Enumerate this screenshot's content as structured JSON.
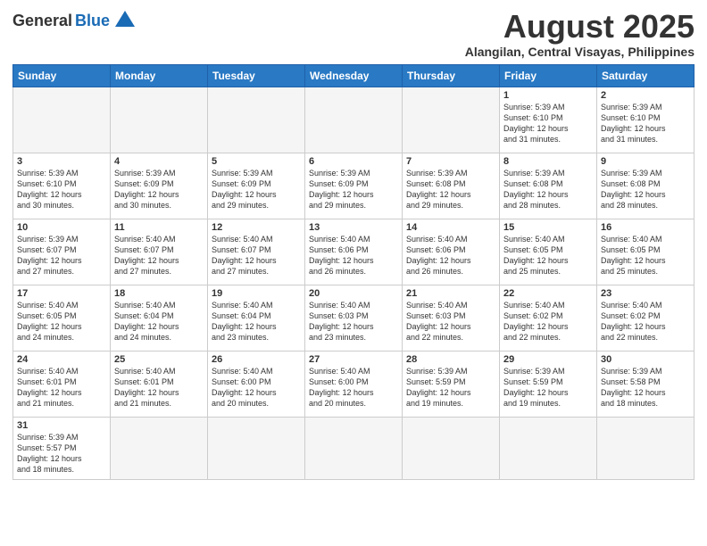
{
  "header": {
    "logo_general": "General",
    "logo_blue": "Blue",
    "month_title": "August 2025",
    "location": "Alangilan, Central Visayas, Philippines"
  },
  "weekdays": [
    "Sunday",
    "Monday",
    "Tuesday",
    "Wednesday",
    "Thursday",
    "Friday",
    "Saturday"
  ],
  "weeks": [
    [
      {
        "day": "",
        "info": ""
      },
      {
        "day": "",
        "info": ""
      },
      {
        "day": "",
        "info": ""
      },
      {
        "day": "",
        "info": ""
      },
      {
        "day": "",
        "info": ""
      },
      {
        "day": "1",
        "info": "Sunrise: 5:39 AM\nSunset: 6:10 PM\nDaylight: 12 hours\nand 31 minutes."
      },
      {
        "day": "2",
        "info": "Sunrise: 5:39 AM\nSunset: 6:10 PM\nDaylight: 12 hours\nand 31 minutes."
      }
    ],
    [
      {
        "day": "3",
        "info": "Sunrise: 5:39 AM\nSunset: 6:10 PM\nDaylight: 12 hours\nand 30 minutes."
      },
      {
        "day": "4",
        "info": "Sunrise: 5:39 AM\nSunset: 6:09 PM\nDaylight: 12 hours\nand 30 minutes."
      },
      {
        "day": "5",
        "info": "Sunrise: 5:39 AM\nSunset: 6:09 PM\nDaylight: 12 hours\nand 29 minutes."
      },
      {
        "day": "6",
        "info": "Sunrise: 5:39 AM\nSunset: 6:09 PM\nDaylight: 12 hours\nand 29 minutes."
      },
      {
        "day": "7",
        "info": "Sunrise: 5:39 AM\nSunset: 6:08 PM\nDaylight: 12 hours\nand 29 minutes."
      },
      {
        "day": "8",
        "info": "Sunrise: 5:39 AM\nSunset: 6:08 PM\nDaylight: 12 hours\nand 28 minutes."
      },
      {
        "day": "9",
        "info": "Sunrise: 5:39 AM\nSunset: 6:08 PM\nDaylight: 12 hours\nand 28 minutes."
      }
    ],
    [
      {
        "day": "10",
        "info": "Sunrise: 5:39 AM\nSunset: 6:07 PM\nDaylight: 12 hours\nand 27 minutes."
      },
      {
        "day": "11",
        "info": "Sunrise: 5:40 AM\nSunset: 6:07 PM\nDaylight: 12 hours\nand 27 minutes."
      },
      {
        "day": "12",
        "info": "Sunrise: 5:40 AM\nSunset: 6:07 PM\nDaylight: 12 hours\nand 27 minutes."
      },
      {
        "day": "13",
        "info": "Sunrise: 5:40 AM\nSunset: 6:06 PM\nDaylight: 12 hours\nand 26 minutes."
      },
      {
        "day": "14",
        "info": "Sunrise: 5:40 AM\nSunset: 6:06 PM\nDaylight: 12 hours\nand 26 minutes."
      },
      {
        "day": "15",
        "info": "Sunrise: 5:40 AM\nSunset: 6:05 PM\nDaylight: 12 hours\nand 25 minutes."
      },
      {
        "day": "16",
        "info": "Sunrise: 5:40 AM\nSunset: 6:05 PM\nDaylight: 12 hours\nand 25 minutes."
      }
    ],
    [
      {
        "day": "17",
        "info": "Sunrise: 5:40 AM\nSunset: 6:05 PM\nDaylight: 12 hours\nand 24 minutes."
      },
      {
        "day": "18",
        "info": "Sunrise: 5:40 AM\nSunset: 6:04 PM\nDaylight: 12 hours\nand 24 minutes."
      },
      {
        "day": "19",
        "info": "Sunrise: 5:40 AM\nSunset: 6:04 PM\nDaylight: 12 hours\nand 23 minutes."
      },
      {
        "day": "20",
        "info": "Sunrise: 5:40 AM\nSunset: 6:03 PM\nDaylight: 12 hours\nand 23 minutes."
      },
      {
        "day": "21",
        "info": "Sunrise: 5:40 AM\nSunset: 6:03 PM\nDaylight: 12 hours\nand 22 minutes."
      },
      {
        "day": "22",
        "info": "Sunrise: 5:40 AM\nSunset: 6:02 PM\nDaylight: 12 hours\nand 22 minutes."
      },
      {
        "day": "23",
        "info": "Sunrise: 5:40 AM\nSunset: 6:02 PM\nDaylight: 12 hours\nand 22 minutes."
      }
    ],
    [
      {
        "day": "24",
        "info": "Sunrise: 5:40 AM\nSunset: 6:01 PM\nDaylight: 12 hours\nand 21 minutes."
      },
      {
        "day": "25",
        "info": "Sunrise: 5:40 AM\nSunset: 6:01 PM\nDaylight: 12 hours\nand 21 minutes."
      },
      {
        "day": "26",
        "info": "Sunrise: 5:40 AM\nSunset: 6:00 PM\nDaylight: 12 hours\nand 20 minutes."
      },
      {
        "day": "27",
        "info": "Sunrise: 5:40 AM\nSunset: 6:00 PM\nDaylight: 12 hours\nand 20 minutes."
      },
      {
        "day": "28",
        "info": "Sunrise: 5:39 AM\nSunset: 5:59 PM\nDaylight: 12 hours\nand 19 minutes."
      },
      {
        "day": "29",
        "info": "Sunrise: 5:39 AM\nSunset: 5:59 PM\nDaylight: 12 hours\nand 19 minutes."
      },
      {
        "day": "30",
        "info": "Sunrise: 5:39 AM\nSunset: 5:58 PM\nDaylight: 12 hours\nand 18 minutes."
      }
    ],
    [
      {
        "day": "31",
        "info": "Sunrise: 5:39 AM\nSunset: 5:57 PM\nDaylight: 12 hours\nand 18 minutes."
      },
      {
        "day": "",
        "info": ""
      },
      {
        "day": "",
        "info": ""
      },
      {
        "day": "",
        "info": ""
      },
      {
        "day": "",
        "info": ""
      },
      {
        "day": "",
        "info": ""
      },
      {
        "day": "",
        "info": ""
      }
    ]
  ]
}
